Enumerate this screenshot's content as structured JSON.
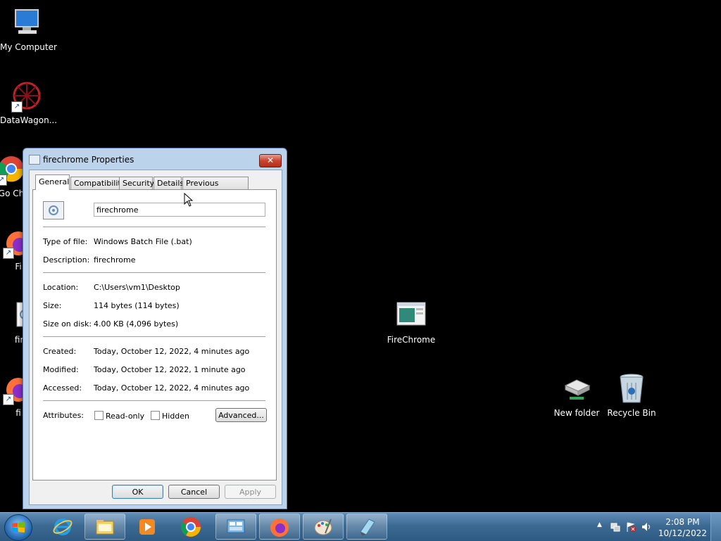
{
  "desktop": {
    "icons": [
      {
        "label": "My Computer"
      },
      {
        "label": "DataWagon..."
      },
      {
        "label": "Go Ch"
      },
      {
        "label": "Fi"
      },
      {
        "label": "firec"
      },
      {
        "label": "fi"
      },
      {
        "label": "FireChrome"
      },
      {
        "label": "New folder"
      },
      {
        "label": "Recycle Bin"
      }
    ]
  },
  "dialog": {
    "title": "firechrome Properties",
    "close_label": "✕",
    "tabs": [
      "General",
      "Compatibility",
      "Security",
      "Details",
      "Previous Versions"
    ],
    "active_tab": "General",
    "file_name": "firechrome",
    "fields": {
      "type_label": "Type of file:",
      "type_value": "Windows Batch File (.bat)",
      "desc_label": "Description:",
      "desc_value": "firechrome",
      "location_label": "Location:",
      "location_value": "C:\\Users\\vm1\\Desktop",
      "size_label": "Size:",
      "size_value": "114 bytes (114 bytes)",
      "sizedisk_label": "Size on disk:",
      "sizedisk_value": "4.00 KB (4,096 bytes)",
      "created_label": "Created:",
      "created_value": "Today, October 12, 2022, 4 minutes ago",
      "modified_label": "Modified:",
      "modified_value": "Today, October 12, 2022, 1 minute ago",
      "accessed_label": "Accessed:",
      "accessed_value": "Today, October 12, 2022, 4 minutes ago",
      "attributes_label": "Attributes:",
      "readonly_label": "Read-only",
      "hidden_label": "Hidden",
      "advanced_label": "Advanced..."
    },
    "buttons": {
      "ok": "OK",
      "cancel": "Cancel",
      "apply": "Apply"
    }
  },
  "taskbar": {
    "time": "2:08 PM",
    "date": "10/12/2022",
    "tray_arrow": "▲"
  },
  "colors": {
    "accent": "#3d6a93",
    "desktop_bg": "#000000"
  }
}
